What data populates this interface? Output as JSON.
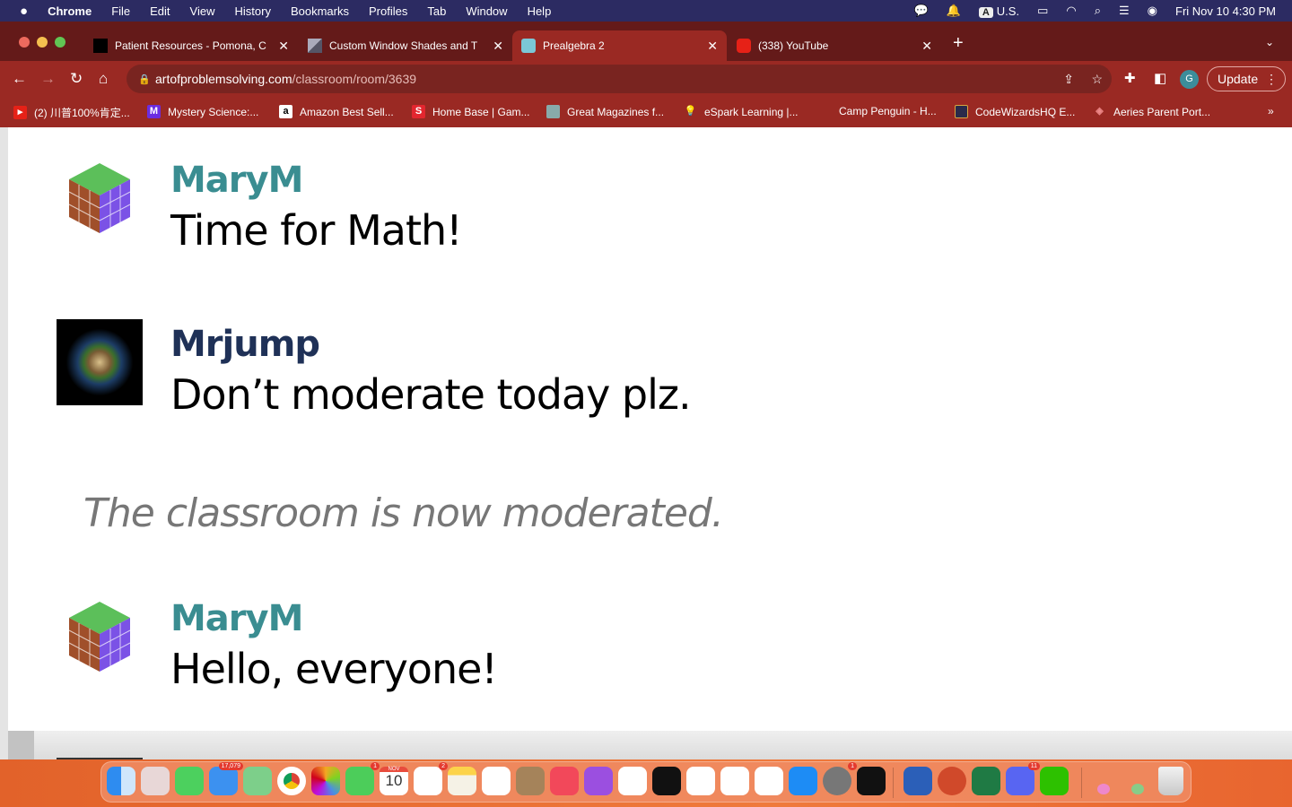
{
  "menubar": {
    "app": "Chrome",
    "items": [
      "File",
      "Edit",
      "View",
      "History",
      "Bookmarks",
      "Profiles",
      "Tab",
      "Window",
      "Help"
    ],
    "input_source": "U.S.",
    "input_badge": "A",
    "clock": "Fri Nov 10  4:30 PM"
  },
  "tabs": [
    {
      "title": "Patient Resources - Pomona, C",
      "active": false
    },
    {
      "title": "Custom Window Shades and T",
      "active": false
    },
    {
      "title": "Prealgebra 2",
      "active": true
    },
    {
      "title": "(338) YouTube",
      "active": false
    }
  ],
  "toolbar": {
    "url_domain": "artofproblemsolving.com",
    "url_path": "/classroom/room/3639",
    "profile_initial": "G",
    "update_label": "Update"
  },
  "bookmarks": [
    "(2) 川普100%肯定...",
    "Mystery Science:...",
    "Amazon Best Sell...",
    "Home Base | Gam...",
    "Great Magazines f...",
    "eSpark Learning |...",
    "Camp Penguin - H...",
    "CodeWizardsHQ E...",
    "Aeries Parent Port..."
  ],
  "bookmarks_more": "»",
  "messages": [
    {
      "user": "MaryM",
      "text": "Time for Math!",
      "color": "#3a8d91",
      "avatar": "cube"
    },
    {
      "user": "Mrjump",
      "text": "Don’t moderate today plz.",
      "color": "#1f3157",
      "avatar": "smiley"
    },
    {
      "user": "MaryM",
      "text": "Hello, everyone!",
      "color": "#3a8d91",
      "avatar": "cube"
    }
  ],
  "system_message": "The classroom is now moderated.",
  "dock": {
    "mail_badge": "17,079",
    "facetime_badge": "1",
    "calendar_month": "NOV",
    "calendar_day": "10",
    "reminders_badge": "2",
    "settings_badge": "1",
    "discord_badge": "11"
  },
  "colors": {
    "menubar": "#2c2b62",
    "tabstrip": "#641a19",
    "toolbar": "#9a2923"
  }
}
